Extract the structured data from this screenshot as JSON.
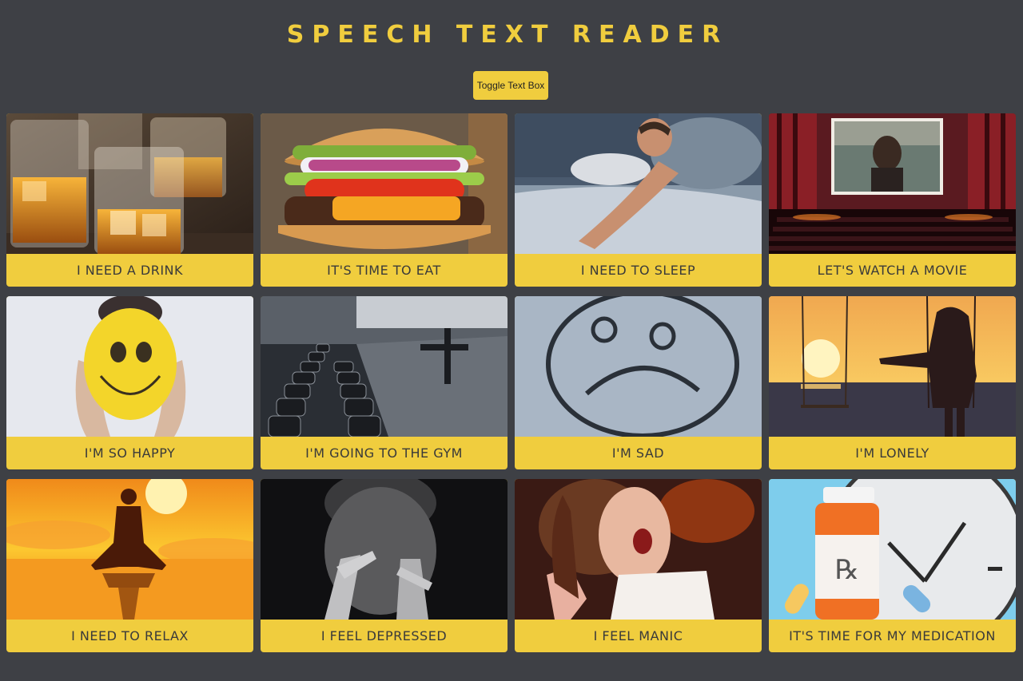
{
  "header": {
    "title": "Speech Text Reader",
    "toggle_label": "Toggle Text Box"
  },
  "cards": [
    {
      "label": "I NEED A DRINK",
      "image": "whiskey-glasses-image"
    },
    {
      "label": "IT'S TIME TO EAT",
      "image": "burger-image"
    },
    {
      "label": "I NEED TO SLEEP",
      "image": "sleeping-man-image"
    },
    {
      "label": "LET'S WATCH A MOVIE",
      "image": "cinema-image"
    },
    {
      "label": "I'M SO HAPPY",
      "image": "smiley-balloon-image"
    },
    {
      "label": "I'M GOING TO THE GYM",
      "image": "gym-dumbbells-image"
    },
    {
      "label": "I'M SAD",
      "image": "sad-face-snow-image"
    },
    {
      "label": "I'M LONELY",
      "image": "swing-sunset-image"
    },
    {
      "label": "I NEED TO RELAX",
      "image": "meditation-image"
    },
    {
      "label": "I FEEL DEPRESSED",
      "image": "depressed-man-image"
    },
    {
      "label": "I FEEL MANIC",
      "image": "laughing-woman-image"
    },
    {
      "label": "IT'S TIME FOR MY MEDICATION",
      "image": "medication-clock-image"
    }
  ],
  "colors": {
    "background": "#3e4045",
    "accent": "#f0cd3e",
    "label_text": "#3a3a3a"
  }
}
